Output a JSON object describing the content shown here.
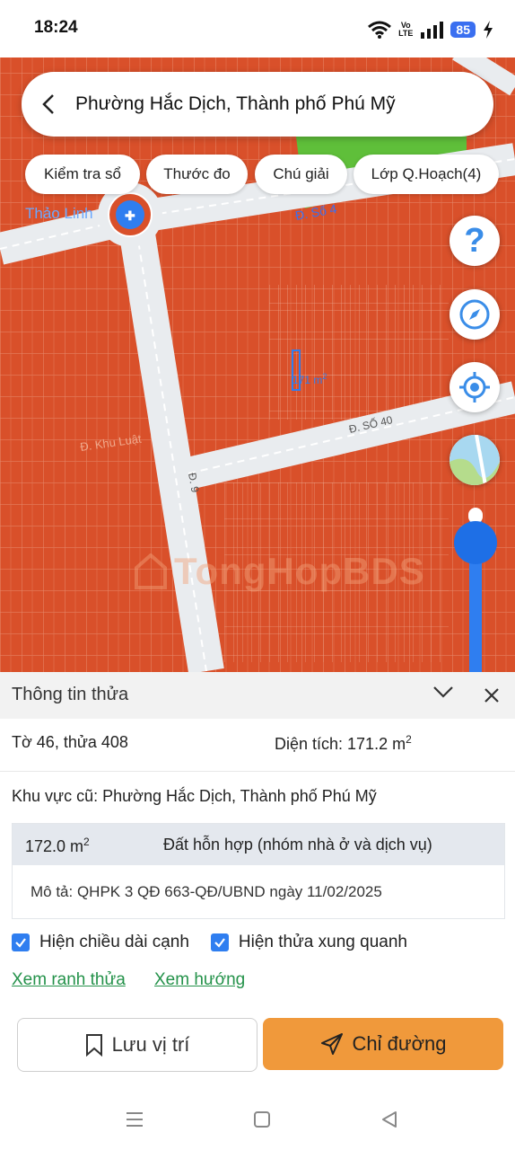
{
  "status_bar": {
    "time": "18:24",
    "volte": "Vo\nLTE",
    "battery": "85"
  },
  "search": {
    "title": "Phường Hắc Dịch, Thành phố Phú Mỹ"
  },
  "chips": [
    {
      "label": "Kiểm tra sổ"
    },
    {
      "label": "Thước đo"
    },
    {
      "label": "Chú giải"
    },
    {
      "label": "Lớp Q.Hoạch(4)"
    }
  ],
  "map": {
    "place_label": "Thảo Linh",
    "street_top": "Đ. Số 4",
    "street_right": "Đ. SỐ 40",
    "road_vertical": "Đ. 9",
    "road_left": "Đ. Khu Luật",
    "area_label": "171 m",
    "area_sup": "2",
    "watermark": "TongHopBDS",
    "help_icon": "?"
  },
  "panel": {
    "title": "Thông tin thửa",
    "lot": "Tờ 46, thửa 408",
    "area_label": "Diện tích: 171.2 m",
    "area_sup": "2",
    "old_area": "Khu vực cũ: Phường Hắc Dịch, Thành phố Phú Mỹ",
    "zone_area": "172.0 m",
    "zone_area_sup": "2",
    "zone_type": "Đất hỗn hợp (nhóm nhà ở và dịch vụ)",
    "zone_desc": "Mô tả: QHPK 3 QĐ 663-QĐ/UBND ngày 11/02/2025",
    "check_edges": "Hiện chiều dài cạnh",
    "check_neighbors": "Hiện thửa xung quanh",
    "link_boundary": "Xem ranh thửa",
    "link_direction": "Xem hướng",
    "btn_save": "Lưu vị trí",
    "btn_route": "Chỉ đường"
  },
  "colors": {
    "accent_blue": "#2f7ef0",
    "map_orange": "#d9502a",
    "route_orange": "#f0993b",
    "link_green": "#24924a"
  }
}
